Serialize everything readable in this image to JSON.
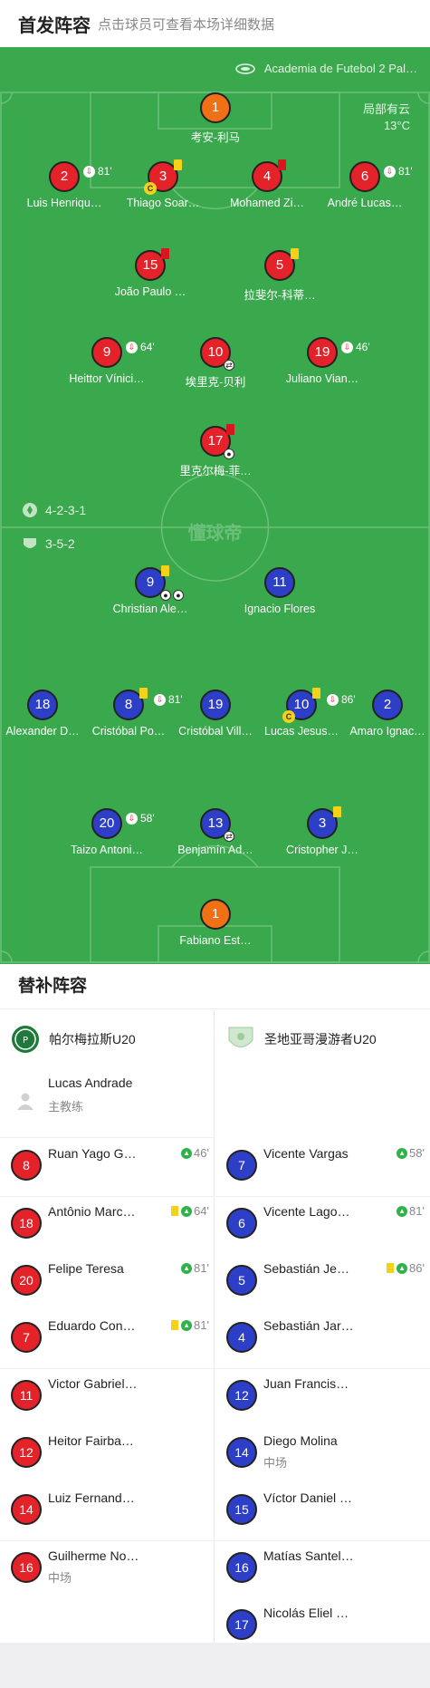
{
  "header": {
    "title": "首发阵容",
    "subtitle": "点击球员可查看本场详细数据"
  },
  "pitch": {
    "venue": "Academia de Futebol 2 Pal…",
    "weather": "局部有云",
    "temperature": "13°C",
    "watermark": "懂球帝",
    "home_formation": "4-2-3-1",
    "away_formation": "3-5-2",
    "colors": {
      "home": "#e3222a",
      "away": "#2e3fc7",
      "gk": "#f07016",
      "pitch": "#3aa84c"
    }
  },
  "home_players": [
    {
      "num": "1",
      "name": "考安-利马"
    },
    {
      "num": "2",
      "name": "Luis Henriqu…",
      "sub": "81'"
    },
    {
      "num": "3",
      "name": "Thiago Soar…"
    },
    {
      "num": "4",
      "name": "Mohamed Zi…"
    },
    {
      "num": "6",
      "name": "André Lucas…",
      "sub": "81'"
    },
    {
      "num": "15",
      "name": "João Paulo …"
    },
    {
      "num": "5",
      "name": "拉斐尔-科蒂…"
    },
    {
      "num": "9",
      "name": "Heittor Vínici…",
      "sub": "64'"
    },
    {
      "num": "10",
      "name": "埃里克-贝利"
    },
    {
      "num": "19",
      "name": "Juliano Vian…",
      "sub": "46'"
    },
    {
      "num": "17",
      "name": "里克尔梅-菲…"
    }
  ],
  "away_players": [
    {
      "num": "9",
      "name": "Christian Ale…"
    },
    {
      "num": "11",
      "name": "Ignacio Flores"
    },
    {
      "num": "18",
      "name": "Alexander D…"
    },
    {
      "num": "8",
      "name": "Cristóbal Po…",
      "sub": "81'"
    },
    {
      "num": "19",
      "name": "Cristóbal Vill…"
    },
    {
      "num": "10",
      "name": "Lucas Jesus…",
      "sub": "86'"
    },
    {
      "num": "2",
      "name": "Amaro Ignac…"
    },
    {
      "num": "20",
      "name": "Taizo Antoni…",
      "sub": "58'"
    },
    {
      "num": "13",
      "name": "Benjamín Ad…"
    },
    {
      "num": "3",
      "name": "Cristopher J…"
    },
    {
      "num": "1",
      "name": "Fabiano Est…"
    }
  ],
  "bench": {
    "title": "替补阵容",
    "home": {
      "team": "帕尔梅拉斯U20",
      "coach": {
        "name": "Lucas Andrade",
        "role": "主教练"
      },
      "players": [
        {
          "num": "8",
          "name": "Ruan Yago G…",
          "event": "46'"
        },
        {
          "num": "18",
          "name": "Antônio Marc…",
          "event": "64'"
        },
        {
          "num": "20",
          "name": "Felipe Teresa",
          "event": "81'"
        },
        {
          "num": "7",
          "name": "Eduardo Con…",
          "event": "81'"
        },
        {
          "num": "11",
          "name": "Victor Gabriel…"
        },
        {
          "num": "12",
          "name": "Heitor Fairba…"
        },
        {
          "num": "14",
          "name": "Luiz Fernand…"
        },
        {
          "num": "16",
          "name": "Guilherme No…",
          "pos": "中场"
        }
      ]
    },
    "away": {
      "team": "圣地亚哥漫游者U20",
      "players": [
        {
          "num": "7",
          "name": "Vicente Vargas",
          "event": "58'"
        },
        {
          "num": "6",
          "name": "Vicente Lago…",
          "event": "81'"
        },
        {
          "num": "5",
          "name": "Sebastián Je…",
          "event": "86'"
        },
        {
          "num": "4",
          "name": "Sebastián Jar…"
        },
        {
          "num": "12",
          "name": "Juan Francis…"
        },
        {
          "num": "14",
          "name": "Diego Molina",
          "pos": "中场"
        },
        {
          "num": "15",
          "name": "Víctor Daniel …"
        },
        {
          "num": "16",
          "name": "Matías Santel…"
        },
        {
          "num": "17",
          "name": "Nicolás Eliel …"
        }
      ]
    }
  }
}
